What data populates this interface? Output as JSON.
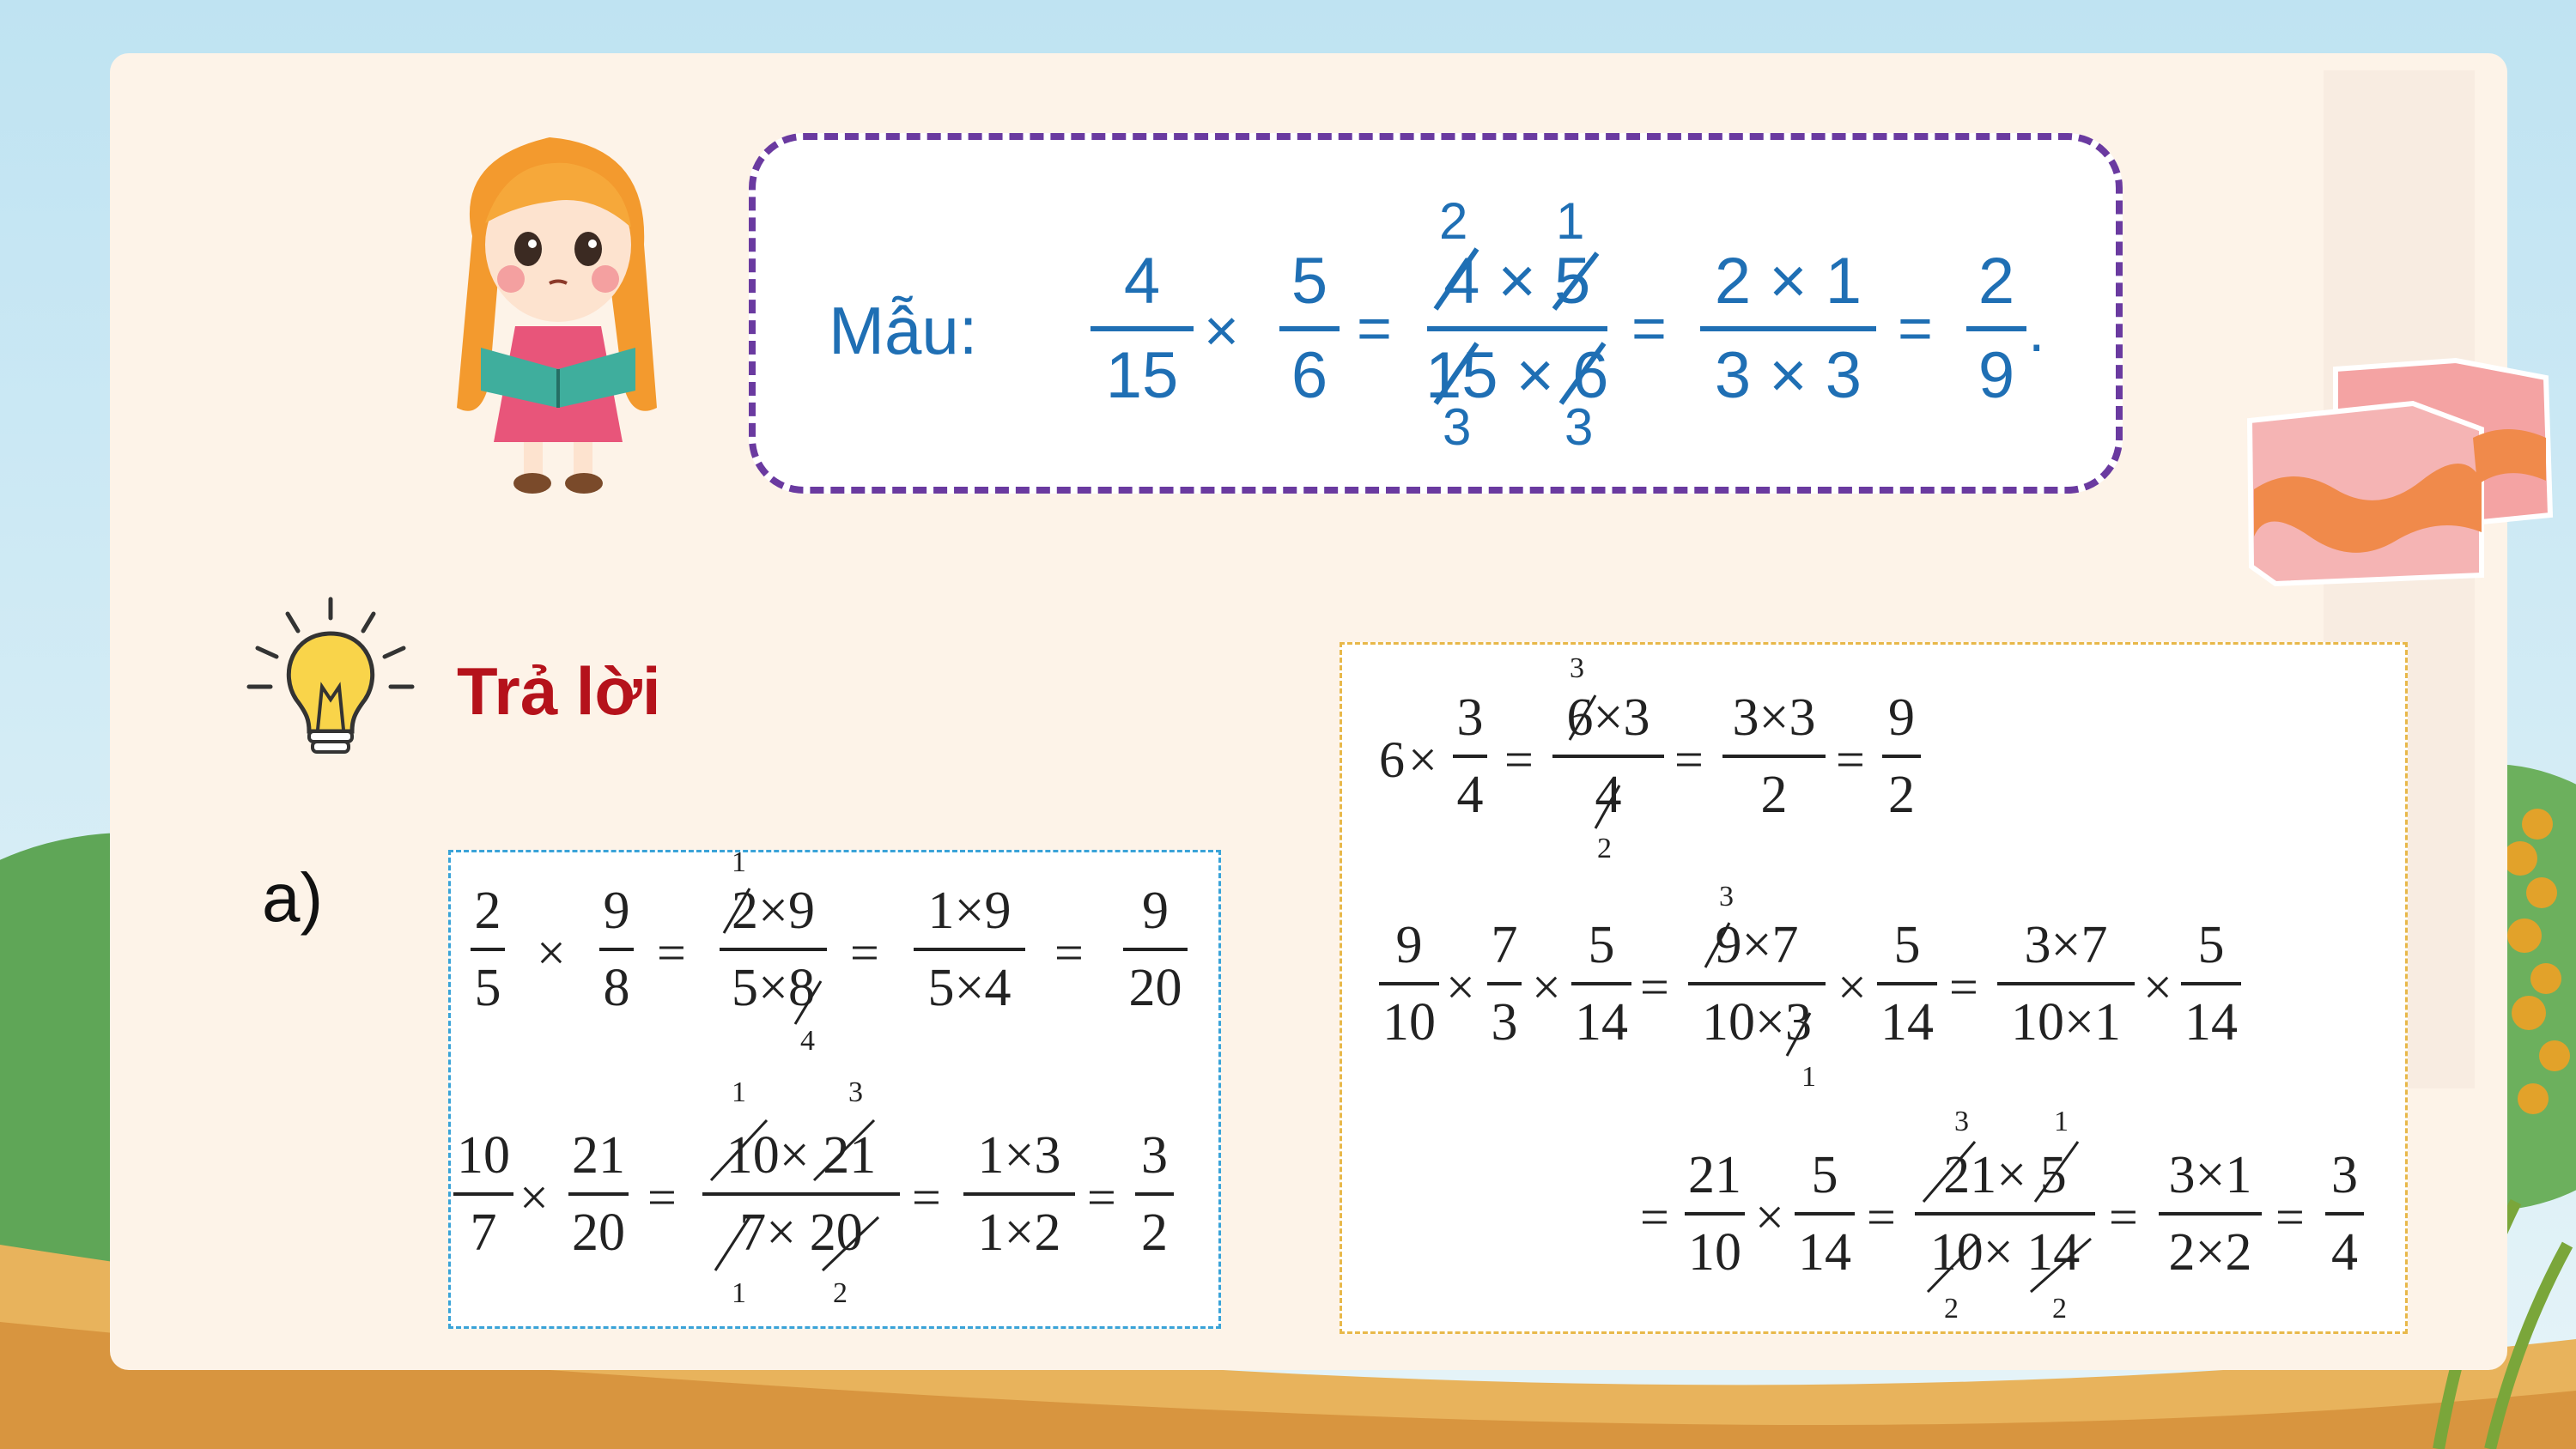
{
  "sample": {
    "label": "Mẫu:",
    "f1_num": "4",
    "f1_den": "15",
    "times": "×",
    "f2_num": "5",
    "f2_den": "6",
    "eq": "=",
    "f3_num": "4 × 5",
    "f3_den": "15 × 6",
    "f3_num_small_left": "2",
    "f3_num_small_right": "1",
    "f3_den_small_left": "3",
    "f3_den_small_right": "3",
    "f4_num": "2 × 1",
    "f4_den": "3 × 3",
    "f5_num": "2",
    "f5_den": "9",
    "period": "."
  },
  "answer": {
    "title": "Trả lời",
    "part_label": "a)"
  },
  "box_a": {
    "row1": {
      "f1": [
        "2",
        "5"
      ],
      "op1": "×",
      "f2": [
        "9",
        "8"
      ],
      "eq1": "=",
      "f3": [
        "2×9",
        "5×8"
      ],
      "f3_small_top": "1",
      "f3_small_bottom": "4",
      "eq2": "=",
      "f4": [
        "1×9",
        "5×4"
      ],
      "eq3": "=",
      "f5": [
        "9",
        "20"
      ]
    },
    "row2": {
      "f1": [
        "10",
        "7"
      ],
      "op1": "×",
      "f2": [
        "21",
        "20"
      ],
      "eq1": "=",
      "f3": [
        "10× 21",
        "7× 20"
      ],
      "f3_small_top_left": "1",
      "f3_small_top_right": "3",
      "f3_small_bottom_left": "1",
      "f3_small_bottom_right": "2",
      "eq2": "=",
      "f4": [
        "1×3",
        "1×2"
      ],
      "eq3": "=",
      "f5": [
        "3",
        "2"
      ]
    }
  },
  "box_b": {
    "row1": {
      "whole": "6",
      "op1": "×",
      "f1": [
        "3",
        "4"
      ],
      "eq1": "=",
      "f2": [
        "6×3",
        "4"
      ],
      "f2_small_top": "3",
      "f2_small_bottom": "2",
      "eq2": "=",
      "f3": [
        "3×3",
        "2"
      ],
      "eq3": "=",
      "f4": [
        "9",
        "2"
      ]
    },
    "row2": {
      "f1": [
        "9",
        "10"
      ],
      "op1": "×",
      "f2": [
        "7",
        "3"
      ],
      "op2": "×",
      "f3": [
        "5",
        "14"
      ],
      "eq1": "=",
      "f4": [
        "9×7",
        "10×3"
      ],
      "f4_small_top": "3",
      "f4_small_bottom": "1",
      "op3": "×",
      "f5": [
        "5",
        "14"
      ],
      "eq2": "=",
      "f6": [
        "3×7",
        "10×1"
      ],
      "op4": "×",
      "f7": [
        "5",
        "14"
      ]
    },
    "row3": {
      "eq0": "=",
      "f1": [
        "21",
        "10"
      ],
      "op1": "×",
      "f2": [
        "5",
        "14"
      ],
      "eq1": "=",
      "f3": [
        "21× 5",
        "10× 14"
      ],
      "f3_small_top_left": "3",
      "f3_small_top_right": "1",
      "f3_small_bottom_left": "2",
      "f3_small_bottom_right": "2",
      "eq2": "=",
      "f4": [
        "3×1",
        "2×2"
      ],
      "eq3": "=",
      "f5": [
        "3",
        "4"
      ]
    }
  },
  "colors": {
    "sample_text": "#1f6fb4",
    "sample_border": "#6a3aa0",
    "answer_title": "#b5121b",
    "box_a_border": "#3aa3d8",
    "box_b_border": "#e8b84a"
  },
  "icons": [
    "girl-reading-illustration",
    "lightbulb-icon",
    "cake-illustration"
  ]
}
